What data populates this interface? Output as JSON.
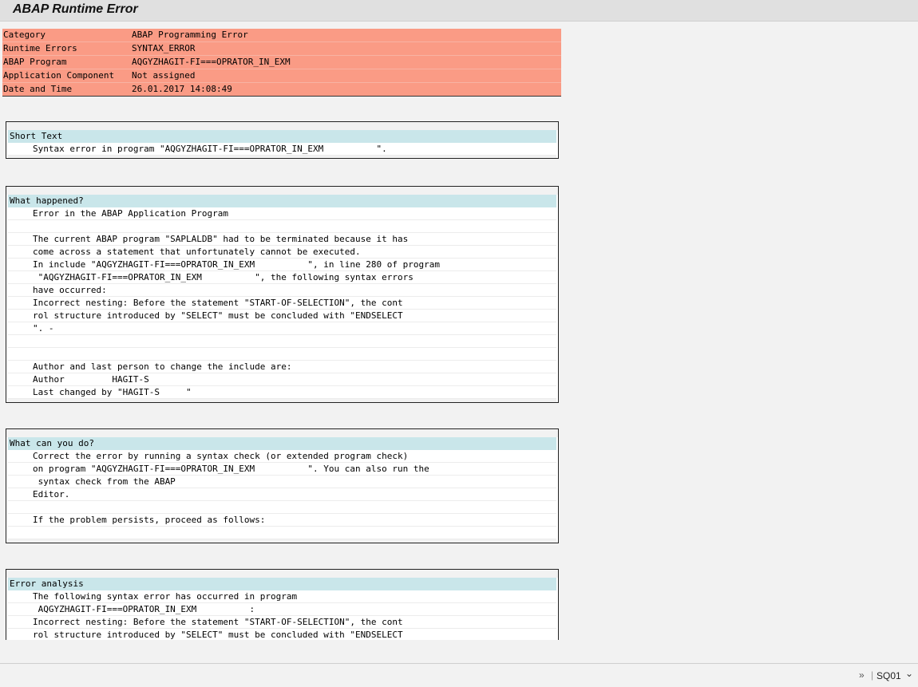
{
  "window": {
    "title": "ABAP Runtime Error"
  },
  "summary": [
    {
      "key": "Category",
      "value": "ABAP Programming Error"
    },
    {
      "key": "Runtime Errors",
      "value": "SYNTAX_ERROR"
    },
    {
      "key": "ABAP Program",
      "value": "AQGYZHAGIT-FI===OPRATOR_IN_EXM"
    },
    {
      "key": "Application Component",
      "value": "Not assigned"
    },
    {
      "key": "Date and Time",
      "value": "26.01.2017 14:08:49"
    }
  ],
  "sections": {
    "short_text": {
      "title": "Short Text",
      "lines": [
        "Syntax error in program \"AQGYZHAGIT-FI===OPRATOR_IN_EXM          \"."
      ]
    },
    "what_happened": {
      "title": "What happened?",
      "lines": [
        "Error in the ABAP Application Program",
        "",
        "The current ABAP program \"SAPLALDB\" had to be terminated because it has",
        "come across a statement that unfortunately cannot be executed.",
        "In include \"AQGYZHAGIT-FI===OPRATOR_IN_EXM          \", in line 280 of program",
        " \"AQGYZHAGIT-FI===OPRATOR_IN_EXM          \", the following syntax errors",
        "have occurred:",
        "Incorrect nesting: Before the statement \"START-OF-SELECTION\", the cont",
        "rol structure introduced by \"SELECT\" must be concluded with \"ENDSELECT",
        "\". -",
        "",
        "",
        "Author and last person to change the include are:",
        "Author         HAGIT-S",
        "Last changed by \"HAGIT-S     \""
      ]
    },
    "what_can_you_do": {
      "title": "What can you do?",
      "lines": [
        "Correct the error by running a syntax check (or extended program check)",
        "on program \"AQGYZHAGIT-FI===OPRATOR_IN_EXM          \". You can also run the",
        " syntax check from the ABAP",
        "Editor.",
        "",
        "If the problem persists, proceed as follows:",
        ""
      ]
    },
    "error_analysis": {
      "title": "Error analysis",
      "lines": [
        "The following syntax error has occurred in program",
        " AQGYZHAGIT-FI===OPRATOR_IN_EXM          :",
        "Incorrect nesting: Before the statement \"START-OF-SELECTION\", the cont",
        "rol structure introduced by \"SELECT\" must be concluded with \"ENDSELECT"
      ]
    }
  },
  "statusbar": {
    "system": "SQ01",
    "expand_icon": "double-chevron-right-icon",
    "dropdown_icon": "chevron-down-icon"
  }
}
